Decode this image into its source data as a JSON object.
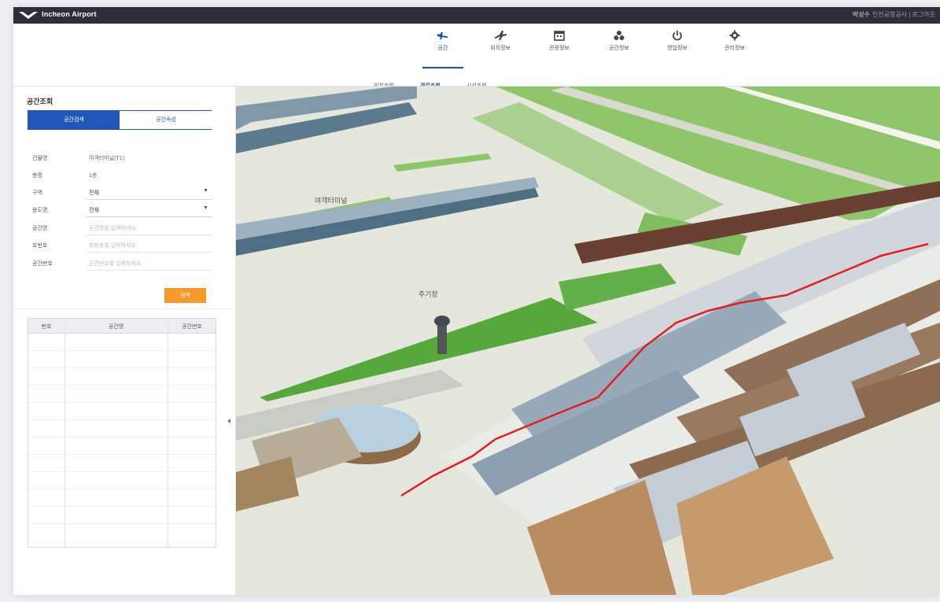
{
  "titlebar": {
    "app_title": "Incheon Airport",
    "user_name": "박성수",
    "user_sub": "인천공항공사 | 로그아웃"
  },
  "topnav": {
    "items": [
      {
        "label": "공간",
        "icon": "airplane-icon",
        "active": true
      },
      {
        "label": "위치정보",
        "icon": "aircraft-icon",
        "active": false
      },
      {
        "label": "관광정보",
        "icon": "calendar-icon",
        "active": false
      },
      {
        "label": "공간정보",
        "icon": "recycle-icon",
        "active": false
      },
      {
        "label": "영업정보",
        "icon": "power-icon",
        "active": false
      },
      {
        "label": "관리정보",
        "icon": "settings-icon",
        "active": false
      }
    ]
  },
  "subtabs": [
    {
      "label": "위치조회",
      "active": false
    },
    {
      "label": "경로조회",
      "active": true
    },
    {
      "label": "시설조회",
      "active": false
    }
  ],
  "sidebar": {
    "title": "공간조회",
    "tabs": {
      "left": "공간검색",
      "right": "공간속성"
    },
    "fields": [
      {
        "label": "건물명",
        "kind": "text",
        "value": "여객터미널(T1)"
      },
      {
        "label": "층명",
        "kind": "text",
        "value": "1층"
      },
      {
        "label": "구역",
        "kind": "select",
        "value": "전체"
      },
      {
        "label": "용도명",
        "kind": "select",
        "value": "전체"
      },
      {
        "label": "공간명",
        "kind": "input",
        "placeholder": "공간명을 입력하세요"
      },
      {
        "label": "호번호",
        "kind": "input",
        "placeholder": "호번호를 입력하세요"
      },
      {
        "label": "공간번호",
        "kind": "input",
        "placeholder": "공간번호를 입력하세요"
      }
    ],
    "search_button": "검색",
    "table": {
      "headers": [
        "번호",
        "공간명",
        "공간번호"
      ],
      "rows": []
    }
  },
  "map": {
    "label_terminal": "여객터미널",
    "label_apron": "주기장"
  }
}
